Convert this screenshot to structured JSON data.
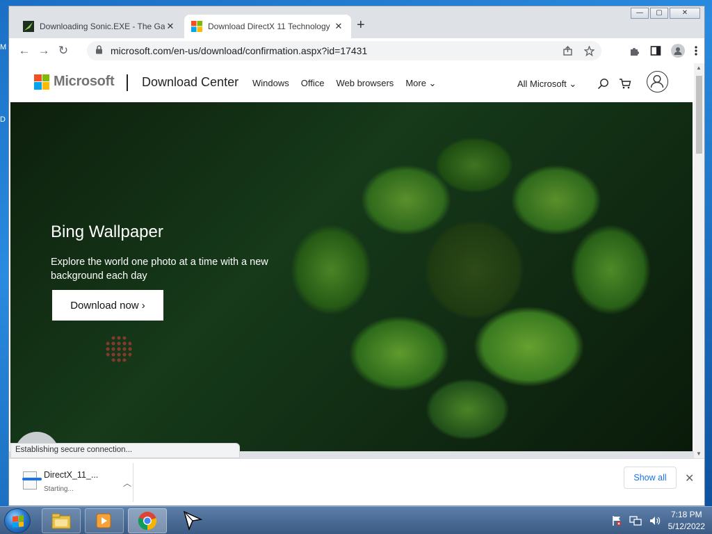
{
  "desktop": {
    "edge_letter_1": "M",
    "edge_letter_2": "D"
  },
  "browser": {
    "tabs": [
      {
        "title": "Downloading Sonic.EXE - The Ga",
        "favicon": "sonic-favicon",
        "close": "✕"
      },
      {
        "title": "Download DirectX 11 Technology",
        "favicon": "microsoft-favicon",
        "close": "✕"
      }
    ],
    "new_tab": "+",
    "window_buttons": {
      "minimize": "—",
      "maximize": "▢",
      "close": "✕"
    },
    "toolbar": {
      "back": "←",
      "forward": "→",
      "reload": "↻"
    },
    "address": {
      "url": "microsoft.com/en-us/download/confirmation.aspx?id=17431"
    },
    "status_text": "Establishing secure connection...",
    "download_shelf": {
      "file_name": "DirectX_11_...",
      "file_status": "Starting...",
      "show_all_label": "Show all",
      "close": "✕"
    }
  },
  "ms_page": {
    "brand": "Microsoft",
    "section": "Download Center",
    "nav": [
      "Windows",
      "Office",
      "Web browsers",
      "More ⌄"
    ],
    "all_microsoft": "All Microsoft ⌄",
    "hero": {
      "title": "Bing Wallpaper",
      "text": "Explore the world one photo at a time with a new background each day",
      "button": "Download now ›"
    },
    "logo_colors": [
      "#f25022",
      "#7fba00",
      "#00a4ef",
      "#ffb900"
    ]
  },
  "taskbar": {
    "clock_time": "7:18 PM",
    "clock_date": "5/12/2022",
    "apps": [
      "file-explorer-icon",
      "media-player-icon",
      "chrome-icon",
      "cursor-icon"
    ]
  }
}
